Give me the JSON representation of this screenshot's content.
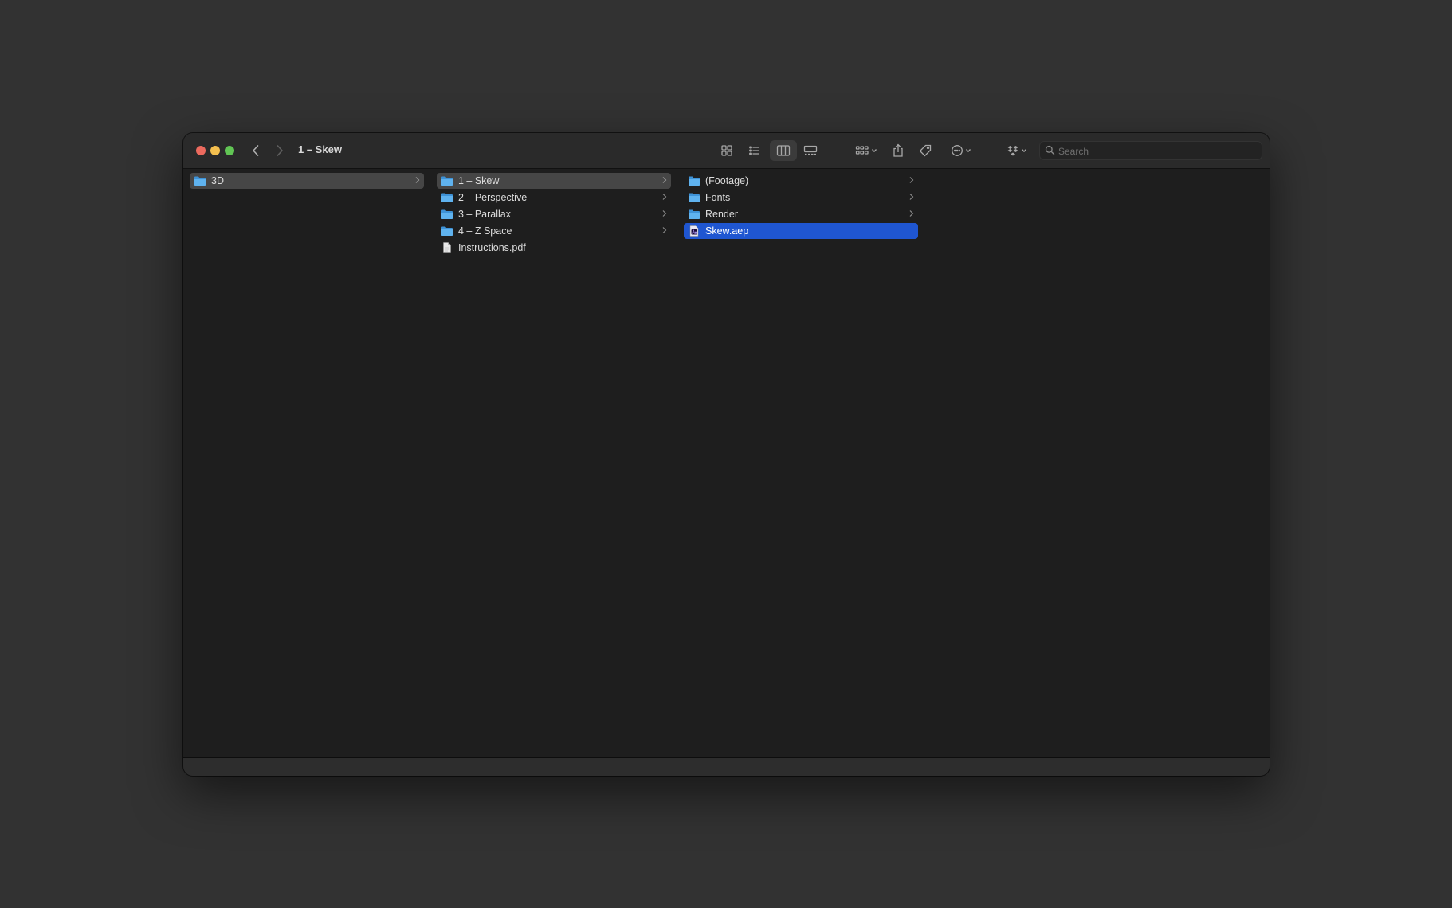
{
  "window": {
    "title": "1 – Skew"
  },
  "toolbar": {
    "icons": [
      "icon-view-icon",
      "list-view-icon",
      "column-view-icon",
      "gallery-view-icon",
      "group-icon",
      "share-icon",
      "tag-icon",
      "more-icon",
      "dropbox-icon"
    ],
    "active_view": "column-view"
  },
  "search": {
    "placeholder": "Search",
    "value": ""
  },
  "columns": [
    {
      "items": [
        {
          "label": "3D",
          "kind": "folder",
          "has_children": true,
          "selected": "gray"
        }
      ]
    },
    {
      "items": [
        {
          "label": "1 – Skew",
          "kind": "folder",
          "has_children": true,
          "selected": "gray"
        },
        {
          "label": "2 – Perspective",
          "kind": "folder",
          "has_children": true,
          "selected": ""
        },
        {
          "label": "3 – Parallax",
          "kind": "folder",
          "has_children": true,
          "selected": ""
        },
        {
          "label": "4 – Z Space",
          "kind": "folder",
          "has_children": true,
          "selected": ""
        },
        {
          "label": "Instructions.pdf",
          "kind": "pdf",
          "has_children": false,
          "selected": ""
        }
      ]
    },
    {
      "items": [
        {
          "label": "(Footage)",
          "kind": "folder",
          "has_children": true,
          "selected": ""
        },
        {
          "label": "Fonts",
          "kind": "folder",
          "has_children": true,
          "selected": ""
        },
        {
          "label": "Render",
          "kind": "folder",
          "has_children": true,
          "selected": ""
        },
        {
          "label": "Skew.aep",
          "kind": "aep",
          "has_children": false,
          "selected": "blue"
        }
      ]
    }
  ],
  "colors": {
    "selection_blue": "#1f56d1",
    "selection_gray": "#464646",
    "folder": "#5fb2ee",
    "background": "#323232"
  }
}
